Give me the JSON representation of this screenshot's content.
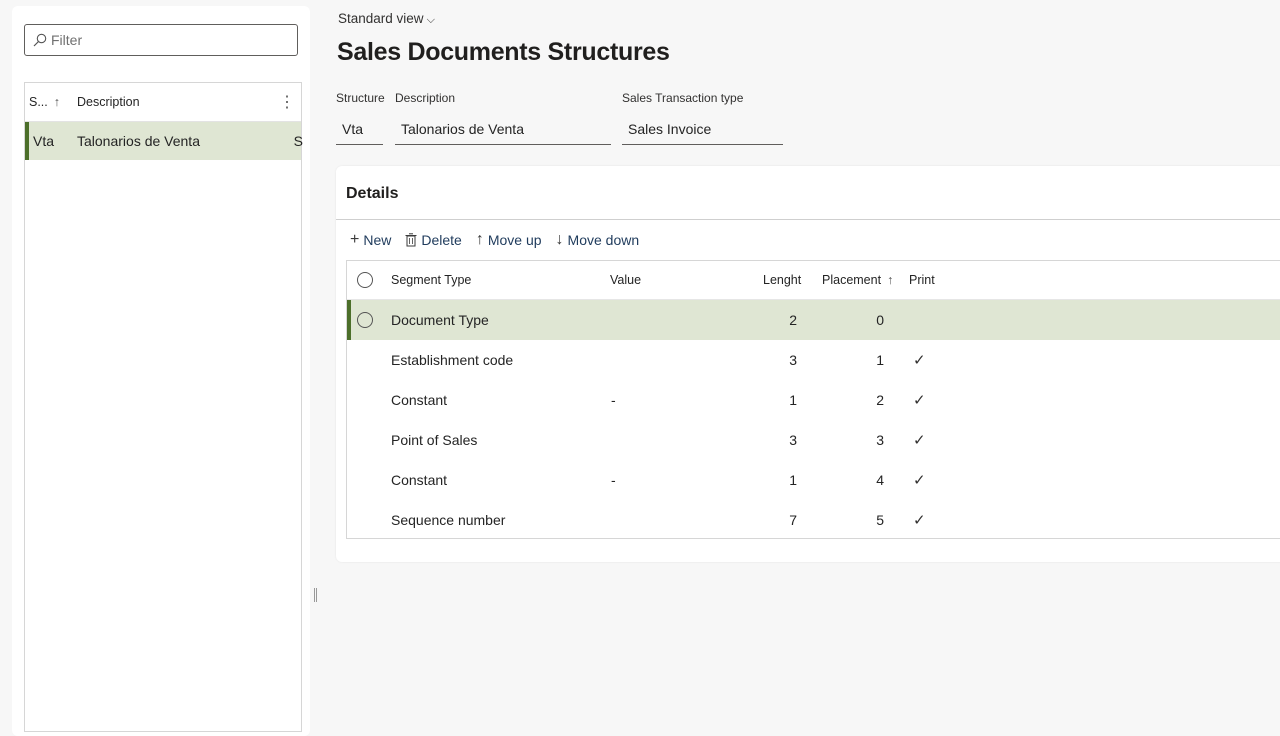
{
  "left_panel": {
    "filter_placeholder": "Filter",
    "columns": {
      "structure": "S...",
      "description": "Description",
      "more": "⋮"
    },
    "rows": [
      {
        "structure": "Vta",
        "description": "Talonarios de Venta",
        "extra": "S"
      }
    ]
  },
  "header": {
    "view": "Standard view",
    "title": "Sales Documents Structures"
  },
  "fields": {
    "structure": {
      "label": "Structure",
      "value": "Vta"
    },
    "description": {
      "label": "Description",
      "value": "Talonarios de Venta"
    },
    "sales_transaction_type": {
      "label": "Sales Transaction type",
      "value": "Sales Invoice"
    }
  },
  "details": {
    "title": "Details",
    "toolbar": {
      "new": "New",
      "delete": "Delete",
      "move_up": "Move up",
      "move_down": "Move down"
    },
    "columns": {
      "segment_type": "Segment Type",
      "value": "Value",
      "length": "Lenght",
      "placement": "Placement",
      "print": "Print"
    },
    "rows": [
      {
        "segment_type": "Document Type",
        "value": "",
        "length": "2",
        "placement": "0",
        "print": ""
      },
      {
        "segment_type": "Establishment code",
        "value": "",
        "length": "3",
        "placement": "1",
        "print": "✓"
      },
      {
        "segment_type": "Constant",
        "value": "-",
        "length": "1",
        "placement": "2",
        "print": "✓"
      },
      {
        "segment_type": "Point of Sales",
        "value": "",
        "length": "3",
        "placement": "3",
        "print": "✓"
      },
      {
        "segment_type": "Constant",
        "value": "-",
        "length": "1",
        "placement": "4",
        "print": "✓"
      },
      {
        "segment_type": "Sequence number",
        "value": "",
        "length": "7",
        "placement": "5",
        "print": "✓"
      }
    ]
  },
  "colors": {
    "selected_row_bg": "#dfe6d3",
    "selected_accent": "#4c6f2a"
  }
}
